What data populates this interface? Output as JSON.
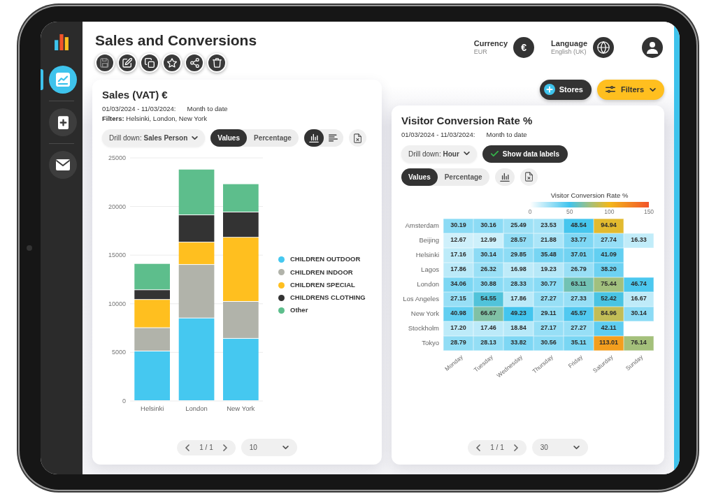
{
  "sidebar": {
    "items": [
      {
        "kind": "chart",
        "selected": true
      },
      {
        "kind": "add",
        "selected": false
      },
      {
        "kind": "mail",
        "selected": false
      }
    ]
  },
  "page": {
    "title": "Sales and Conversions",
    "toolbar": [
      {
        "kind": "save",
        "disabled": true
      },
      {
        "kind": "edit",
        "disabled": false
      },
      {
        "kind": "copy",
        "disabled": false
      },
      {
        "kind": "favorite",
        "disabled": false
      },
      {
        "kind": "share",
        "disabled": false
      },
      {
        "kind": "delete",
        "disabled": false
      }
    ]
  },
  "header": {
    "currency": {
      "label": "Currency",
      "value": "EUR",
      "symbol": "€"
    },
    "language": {
      "label": "Language",
      "value": "English (UK)"
    }
  },
  "actions": {
    "stores": "Stores",
    "filters": "Filters"
  },
  "sales_card": {
    "title": "Sales (VAT) €",
    "date_range": "01/03/2024 - 11/03/2024:",
    "period": "Month to date",
    "filters": "**Filters:** Helsinki, London, New York",
    "drill_down": "Drill down: **Sales Person**",
    "modes": [
      {
        "label": "Values",
        "selected": true
      },
      {
        "label": "Percentage",
        "selected": false
      }
    ],
    "chart_types": [
      {
        "kind": "column",
        "selected": true
      },
      {
        "kind": "bar",
        "selected": false
      }
    ],
    "chart_data": {
      "type": "bar",
      "categories": [
        "Helsinki",
        "London",
        "New York"
      ],
      "series": [
        {
          "name": "CHILDREN OUTDOOR",
          "color": "#45c8f0",
          "values": [
            5100,
            8500,
            6400
          ]
        },
        {
          "name": "CHILDREN INDOOR",
          "color": "#b1b3aa",
          "values": [
            2400,
            5500,
            3800
          ]
        },
        {
          "name": "CHILDREN SPECIAL",
          "color": "#ffbf1f",
          "values": [
            2900,
            2300,
            6600
          ]
        },
        {
          "name": "CHILDRENS CLOTHING",
          "color": "#333333",
          "values": [
            1000,
            2800,
            2600
          ]
        },
        {
          "name": "Other",
          "color": "#5dbe8c",
          "values": [
            2700,
            4700,
            2900
          ]
        }
      ],
      "ylim": [
        0,
        25000
      ],
      "yticks": [
        0,
        5000,
        10000,
        15000,
        20000,
        25000
      ],
      "stacked": true,
      "orientation": "vertical",
      "grid": true,
      "legend": true
    },
    "pagination": {
      "page": "1 / 1",
      "page_size": "10"
    }
  },
  "conversion_card": {
    "title": "Visitor Conversion Rate %",
    "date_range": "01/03/2024 - 11/03/2024:",
    "period": "Month to date",
    "drill_down": "Drill down: **Hour**",
    "show_data_labels": {
      "label": "Show data labels",
      "on": true
    },
    "modes": [
      {
        "label": "Values",
        "selected": true
      },
      {
        "label": "Percentage",
        "selected": false
      }
    ],
    "chart_types": [
      {
        "kind": "column",
        "selected": false
      }
    ],
    "heatmap": {
      "legend_title": "Visitor Conversion Rate %",
      "legend_ticks": [
        "0",
        "50",
        "100",
        "150"
      ],
      "columns": [
        "Monday",
        "Tuesday",
        "Wednesday",
        "Thursday",
        "Friday",
        "Saturday",
        "Sunday"
      ],
      "rows": [
        {
          "label": "Amsterdam",
          "values": [
            "30.19",
            "30.16",
            "25.49",
            "23.53",
            "48.54",
            "94.94"
          ]
        },
        {
          "label": "Beijing",
          "values": [
            "12.67",
            "12.99",
            "28.57",
            "21.88",
            "33.77",
            "27.74",
            "16.33"
          ]
        },
        {
          "label": "Helsinki",
          "values": [
            "17.16",
            "30.14",
            "29.85",
            "35.48",
            "37.01",
            "41.09"
          ]
        },
        {
          "label": "Lagos",
          "values": [
            "17.86",
            "26.32",
            "16.98",
            "19.23",
            "26.79",
            "38.20"
          ]
        },
        {
          "label": "London",
          "values": [
            "34.06",
            "30.88",
            "28.33",
            "30.77",
            "63.11",
            "75.44",
            "46.74"
          ]
        },
        {
          "label": "Los Angeles",
          "values": [
            "27.15",
            "54.55",
            "17.86",
            "27.27",
            "27.33",
            "52.42",
            "16.67"
          ]
        },
        {
          "label": "New York",
          "values": [
            "40.98",
            "66.67",
            "49.23",
            "29.11",
            "45.57",
            "84.96",
            "30.14"
          ]
        },
        {
          "label": "Stockholm",
          "values": [
            "17.20",
            "17.46",
            "18.84",
            "27.17",
            "27.27",
            "42.11"
          ]
        },
        {
          "label": "Tokyo",
          "values": [
            "28.79",
            "28.13",
            "33.82",
            "30.56",
            "35.11",
            "113.01",
            "76.14"
          ]
        }
      ]
    },
    "pagination": {
      "page": "1 / 1",
      "page_size": "30"
    }
  }
}
